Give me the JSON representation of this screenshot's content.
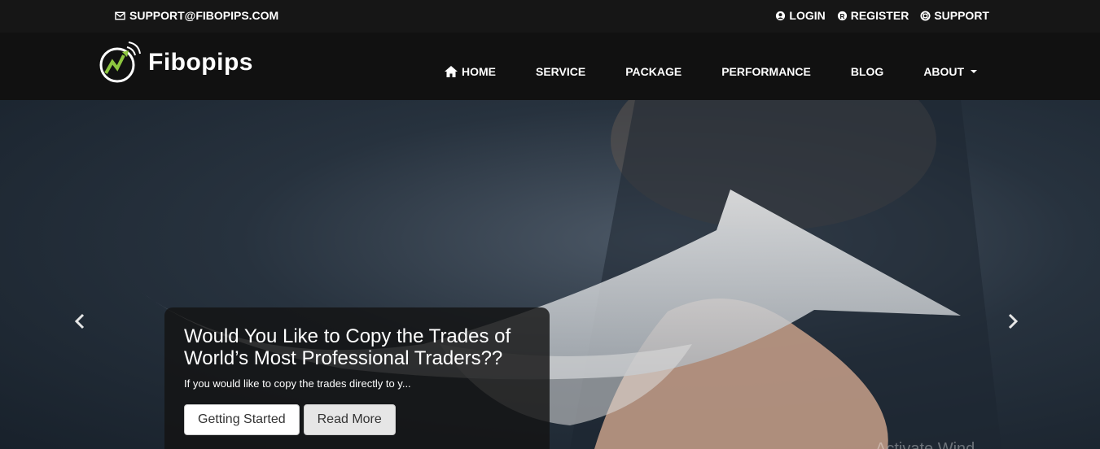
{
  "topbar": {
    "email": "SUPPORT@FIBOPIPS.COM",
    "links": [
      {
        "label": "LOGIN",
        "icon": "user-circle-icon"
      },
      {
        "label": "REGISTER",
        "icon": "registered-icon"
      },
      {
        "label": "SUPPORT",
        "icon": "lifebuoy-icon"
      }
    ]
  },
  "brand": {
    "name": "Fibopips",
    "accent": "#8dc63f"
  },
  "nav": {
    "items": [
      "HOME",
      "SERVICE",
      "PACKAGE",
      "PERFORMANCE",
      "BLOG",
      "ABOUT"
    ]
  },
  "hero": {
    "title": "Would You Like to Copy the Trades of World’s Most Professional Traders??",
    "subtitle": "If you would like to copy the trades directly to y...",
    "buttons": {
      "primary": "Getting Started",
      "secondary": "Read More"
    },
    "watermark": "Activate Wind"
  }
}
